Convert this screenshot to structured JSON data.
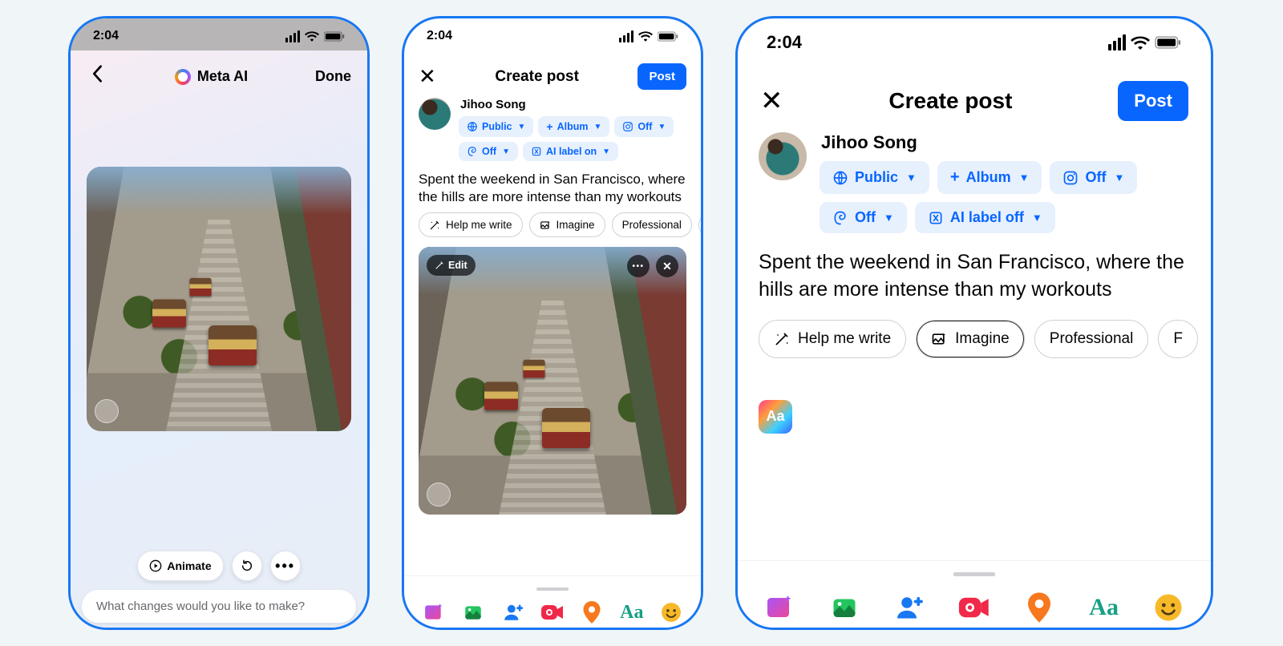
{
  "status": {
    "time": "2:04"
  },
  "phone1": {
    "title": "Meta AI",
    "done": "Done",
    "animate": "Animate",
    "prompt_placeholder": "What changes would you like to make?"
  },
  "create_post": {
    "title": "Create post",
    "post_btn": "Post",
    "username": "Jihoo Song",
    "chips": {
      "audience": "Public",
      "album": "Album",
      "instagram": "Off",
      "threads": "Off",
      "ai_label_on": "AI label on",
      "ai_label_off": "AI label off"
    },
    "post_text": "Spent the weekend in San Francisco, where the hills are more intense than my workouts",
    "suggest": {
      "help_write": "Help me write",
      "imagine": "Imagine",
      "professional": "Professional"
    },
    "edit_overlay": "Edit",
    "style_badge": "Aa",
    "aa_icon": "Aa"
  }
}
